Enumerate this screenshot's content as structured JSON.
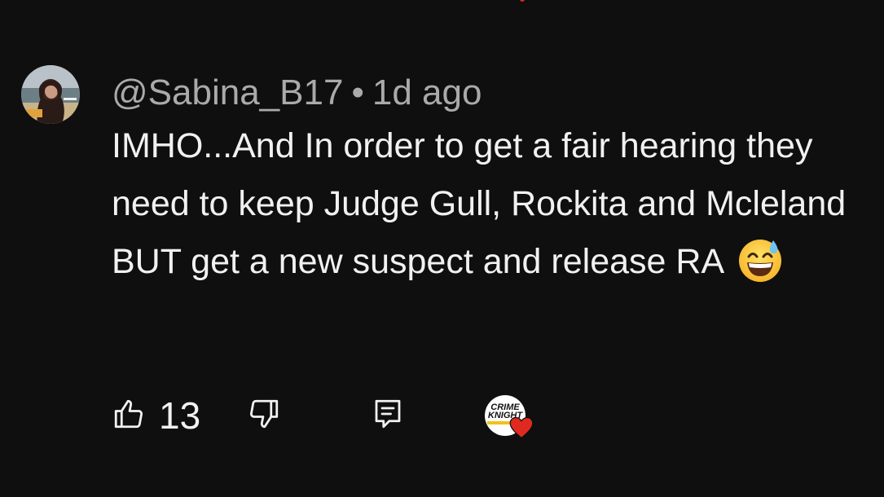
{
  "comment": {
    "author": "@Sabina_B17",
    "separator": "•",
    "time_ago": "1d ago",
    "text": "IMHO...And In order to get a fair hearing they need to keep Judge Gull, Rockita and Mcleland BUT get a new suspect and release RA",
    "emoji": "grinning-face-with-sweat"
  },
  "actions": {
    "like_count": "13",
    "like_icon": "thumbs-up-icon",
    "dislike_icon": "thumbs-down-icon",
    "reply_icon": "reply-icon",
    "creator_heart": {
      "channel_logo_text": "CRIME KNIGHT",
      "heart_color": "#e02a20"
    }
  },
  "colors": {
    "background": "#0f0f0f",
    "primary_text": "#f1f1f1",
    "secondary_text": "#aaaaaa",
    "accent_red": "#e02a20"
  }
}
